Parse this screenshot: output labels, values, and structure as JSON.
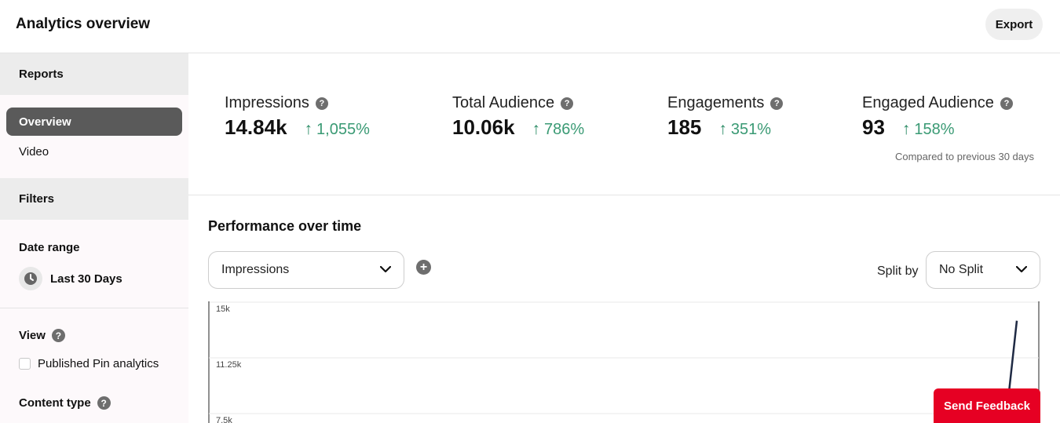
{
  "header": {
    "title": "Analytics overview",
    "export_label": "Export"
  },
  "sidebar": {
    "reports_heading": "Reports",
    "report_items": [
      {
        "label": "Overview",
        "active": true
      },
      {
        "label": "Video",
        "active": false
      }
    ],
    "filters_heading": "Filters",
    "date_range_label": "Date range",
    "date_range_value": "Last 30 Days",
    "view_label": "View",
    "published_pin_label": "Published Pin analytics",
    "content_type_label": "Content type"
  },
  "metrics": [
    {
      "label": "Impressions",
      "value": "14.84k",
      "change": "1,055%"
    },
    {
      "label": "Total Audience",
      "value": "10.06k",
      "change": "786%"
    },
    {
      "label": "Engagements",
      "value": "185",
      "change": "351%"
    },
    {
      "label": "Engaged Audience",
      "value": "93",
      "change": "158%"
    }
  ],
  "compared_note": "Compared to previous 30 days",
  "performance": {
    "title": "Performance over time",
    "metric_select": "Impressions",
    "split_by_label": "Split by",
    "split_select": "No Split"
  },
  "chart_data": {
    "type": "line",
    "y_ticks": [
      "15k",
      "11.25k",
      "7.5k"
    ],
    "y_values": [
      15000,
      11250,
      7500
    ],
    "ylim": [
      7500,
      15000
    ],
    "grid": true,
    "series": [
      {
        "values": [
          14700,
          7500
        ]
      }
    ]
  },
  "feedback_label": "Send Feedback",
  "colors": {
    "accent_green": "#3a9a74",
    "feedback_red": "#e60023",
    "active_nav": "#5a5a5a",
    "line": "#1f2a44"
  },
  "icons": {
    "help": "help-icon",
    "clock": "clock-icon",
    "chevron": "chevron-down-icon",
    "plus": "plus-circle-icon",
    "arrow": "arrow-up-icon"
  }
}
